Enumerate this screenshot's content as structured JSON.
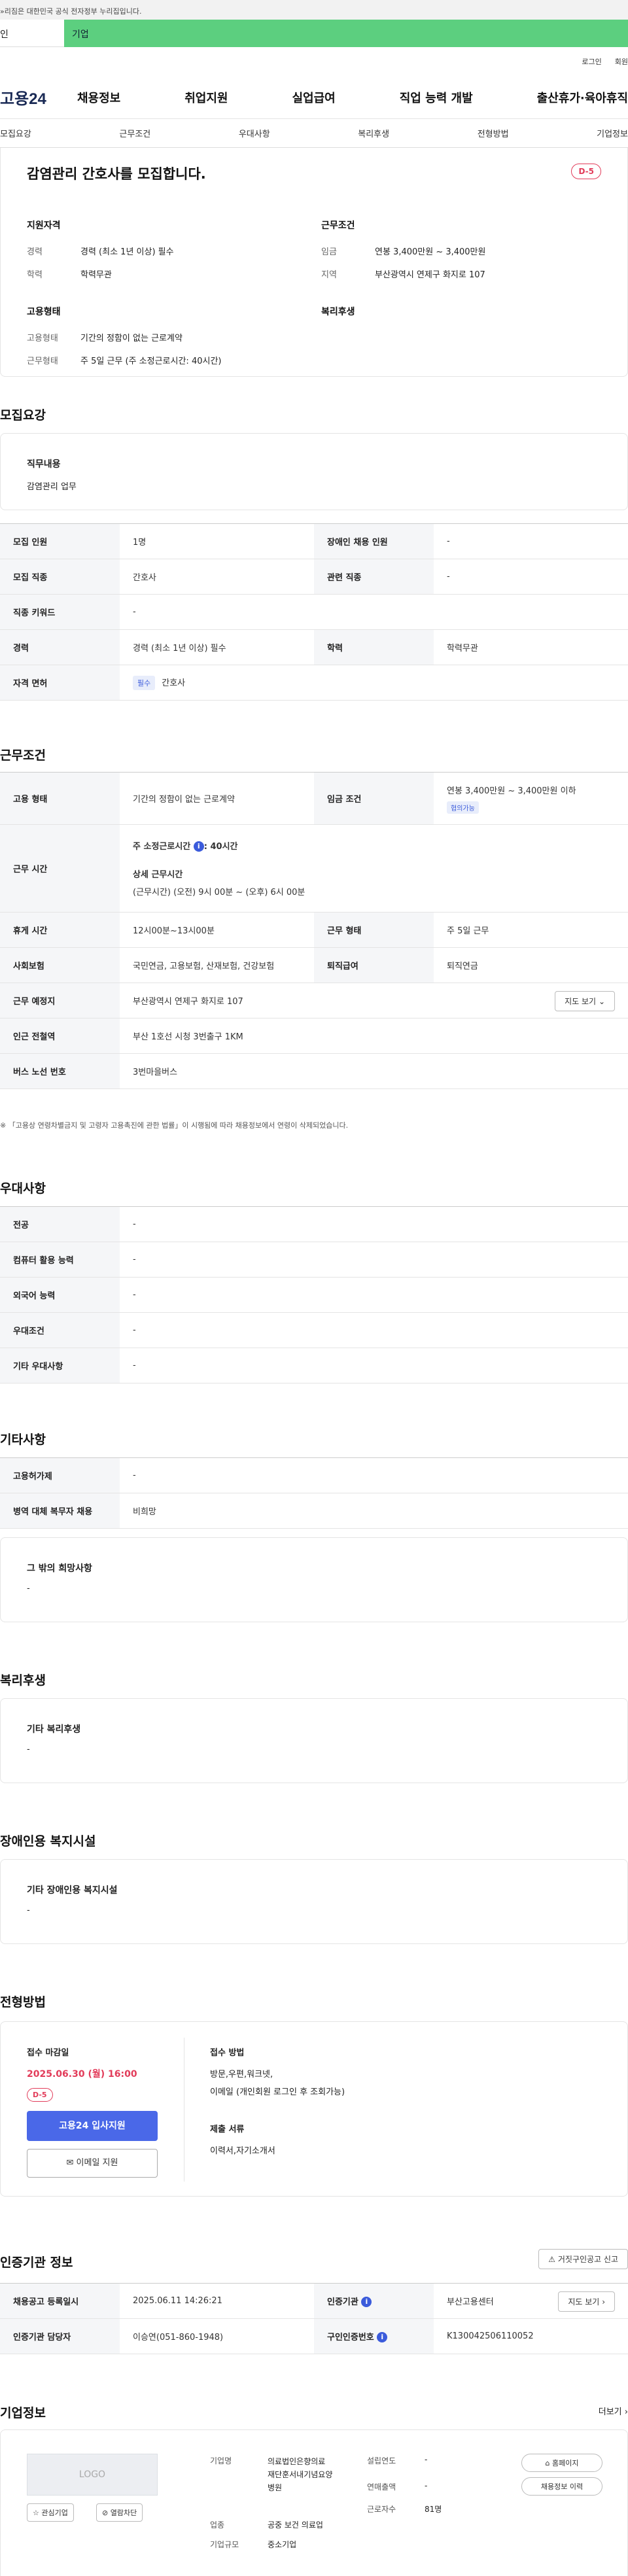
{
  "banner": {
    "gov_notice": "»리짐은 대한민국 공식 전자정부 누리집입니다."
  },
  "tabs": {
    "individual": "인",
    "corporate": "기업"
  },
  "util": {
    "login": "로그인",
    "signup": "회원"
  },
  "gnb": {
    "logo": "고용24",
    "menu": [
      "채용정보",
      "취업지원",
      "실업급여",
      "직업 능력 개발",
      "출산휴가·육아휴직"
    ]
  },
  "subnav": [
    "모집요강",
    "근무조건",
    "우대사항",
    "복리후생",
    "전형방법",
    "기업정보"
  ],
  "summary": {
    "title": "감염관리 간호사를 모집합니다.",
    "dday": "D-5",
    "qual_title": "지원자격",
    "qual": [
      {
        "k": "경력",
        "v": "경력 (최소 1년 이상) 필수"
      },
      {
        "k": "학력",
        "v": "학력무관"
      }
    ],
    "cond_title": "근무조건",
    "cond": [
      {
        "k": "임금",
        "v": "연봉 3,400만원 ~ 3,400만원"
      },
      {
        "k": "지역",
        "v": "부산광역시 연제구 화지로 107"
      }
    ],
    "emp_title": "고용형태",
    "emp": [
      {
        "k": "고용형태",
        "v": "기간의 정함이 없는 근로계약"
      },
      {
        "k": "근무형태",
        "v": "주 5일 근무 (주 소정근로시간: 40시간)"
      }
    ],
    "welfare_title": "복리후생"
  },
  "recruit": {
    "title": "모집요강",
    "duty_label": "직무내용",
    "duty_value": "감염관리 업무",
    "rows": [
      {
        "k1": "모집 인원",
        "v1": "1명",
        "k2": "장애인 채용 인원",
        "v2": "-"
      },
      {
        "k1": "모집 직종",
        "v1": "간호사",
        "k2": "관련 직종",
        "v2": "-"
      },
      {
        "k1": "직종 키워드",
        "v1": "-"
      },
      {
        "k1": "경력",
        "v1": "경력 (최소 1년 이상) 필수",
        "k2": "학력",
        "v2": "학력무관"
      },
      {
        "k1": "자격 면허",
        "chip": "필수",
        "v1": "간호사"
      }
    ]
  },
  "work": {
    "title": "근무조건",
    "emp_type_k": "고용 형태",
    "emp_type_v": "기간의 정함이 없는 근로계약",
    "wage_k": "임금 조건",
    "wage_v": "연봉 3,400만원 ~ 3,400만원 이하",
    "wage_chip": "협의가능",
    "hours_k": "근무 시간",
    "hours_weekly": "주 소정근로시간",
    "hours_weekly_val": ": 40시간",
    "hours_detail_title": "상세 근무시간",
    "hours_detail": "(근무시간) (오전) 9시 00분 ~ (오후) 6시 00분",
    "rest_k": "휴게 시간",
    "rest_v": "12시00분~13시00분",
    "form_k": "근무 형태",
    "form_v": "주 5일 근무",
    "ins_k": "사회보험",
    "ins_v": "국민연금, 고용보험, 산재보험, 건강보험",
    "ret_k": "퇴직급여",
    "ret_v": "퇴직연금",
    "loc_k": "근무 예정지",
    "loc_v": "부산광역시 연제구 화지로 107",
    "map_btn": "지도 보기",
    "sub_k": "인근 전철역",
    "sub_v": "부산 1호선 시청 3번출구 1KM",
    "bus_k": "버스 노선 번호",
    "bus_v": "3번마을버스",
    "note": "※ 「고용상 연령차별금지 및 고령자 고용촉진에 관한 법률」이 시행됨에 따라 채용정보에서 연령이 삭제되었습니다."
  },
  "pref": {
    "title": "우대사항",
    "rows": [
      {
        "k": "전공",
        "v": "-"
      },
      {
        "k": "컴퓨터 활용 능력",
        "v": "-"
      },
      {
        "k": "외국어 능력",
        "v": "-"
      },
      {
        "k": "우대조건",
        "v": "-"
      },
      {
        "k": "기타 우대사항",
        "v": "-"
      }
    ]
  },
  "etc": {
    "title": "기타사항",
    "rows": [
      {
        "k": "고용허가제",
        "v": "-"
      },
      {
        "k": "병역 대체 복무자 채용",
        "v": "비희망"
      }
    ],
    "other_label": "그 밖의 희망사항",
    "other_value": "-"
  },
  "welfare": {
    "title": "복리후생",
    "label": "기타 복리후생",
    "value": "-"
  },
  "disability": {
    "title": "장애인용 복지시설",
    "label": "기타 장애인용 복지시설",
    "value": "-"
  },
  "apply": {
    "title": "전형방법",
    "deadline_label": "접수 마감일",
    "deadline": "2025.06.30 (월) 16:00",
    "dday": "D-5",
    "apply_btn": "고용24 입사지원",
    "email_btn": "이메일 지원",
    "method_label": "접수 방법",
    "method_line1": "방문,우편,워크넷,",
    "method_line2": "이메일 (개인회원 로그인 후 조회가능)",
    "docs_label": "제출 서류",
    "docs_value": "이력서,자기소개서"
  },
  "cert": {
    "title": "인증기관 정보",
    "report_btn": "거짓구인공고 신고",
    "reg_k": "채용공고 등록일시",
    "reg_v": "2025.06.11 14:26:21",
    "org_k": "인증기관",
    "org_v": "부산고용센터",
    "map_btn": "지도 보기",
    "mgr_k": "인증기관 담당자",
    "mgr_v": "이승연(051-860-1948)",
    "no_k": "구인인증번호",
    "no_v": "K130042506110052"
  },
  "company": {
    "title": "기업정보",
    "more": "더보기",
    "logo_text": "LOGO",
    "fav_btn": "관심기업",
    "block_btn": "열람차단",
    "name_k": "기업명",
    "name_v1": "의료법인은향의료",
    "name_v2": "재단훈서내기념요양",
    "name_v3": "병원",
    "ind_k": "업종",
    "ind_v": "공중 보건 의료업",
    "size_k": "기업규모",
    "size_v": "중소기업",
    "est_k": "설립연도",
    "est_v": "-",
    "sales_k": "연매출액",
    "sales_v": "-",
    "emp_k": "근로자수",
    "emp_v": "81명",
    "home_btn": "홈페이지",
    "hist_btn": "채용정보 이력"
  },
  "colors": {
    "accent": "#3b5bdb",
    "dday": "#e23c5a",
    "corp_tab": "#5ccf7f",
    "apply_btn": "#4a68e8"
  }
}
